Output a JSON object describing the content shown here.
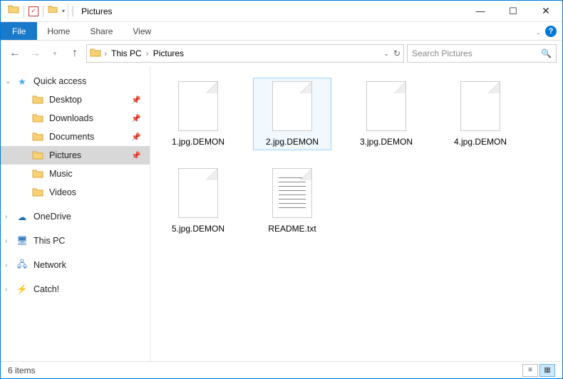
{
  "titlebar": {
    "title": "Pictures"
  },
  "ribbon": {
    "file": "File",
    "tabs": [
      "Home",
      "Share",
      "View"
    ]
  },
  "breadcrumb": {
    "items": [
      "This PC",
      "Pictures"
    ]
  },
  "search": {
    "placeholder": "Search Pictures"
  },
  "sidebar": {
    "quick_access": "Quick access",
    "items": [
      {
        "label": "Desktop",
        "pinned": true
      },
      {
        "label": "Downloads",
        "pinned": true
      },
      {
        "label": "Documents",
        "pinned": true
      },
      {
        "label": "Pictures",
        "pinned": true,
        "selected": true
      },
      {
        "label": "Music",
        "pinned": false
      },
      {
        "label": "Videos",
        "pinned": false
      }
    ],
    "onedrive": "OneDrive",
    "this_pc": "This PC",
    "network": "Network",
    "catch": "Catch!"
  },
  "files": [
    {
      "name": "1.jpg.DEMON",
      "type": "blank"
    },
    {
      "name": "2.jpg.DEMON",
      "type": "blank",
      "selected": true
    },
    {
      "name": "3.jpg.DEMON",
      "type": "blank"
    },
    {
      "name": "4.jpg.DEMON",
      "type": "blank"
    },
    {
      "name": "5.jpg.DEMON",
      "type": "blank"
    },
    {
      "name": "README.txt",
      "type": "txt"
    }
  ],
  "status": {
    "count_text": "6 items"
  }
}
